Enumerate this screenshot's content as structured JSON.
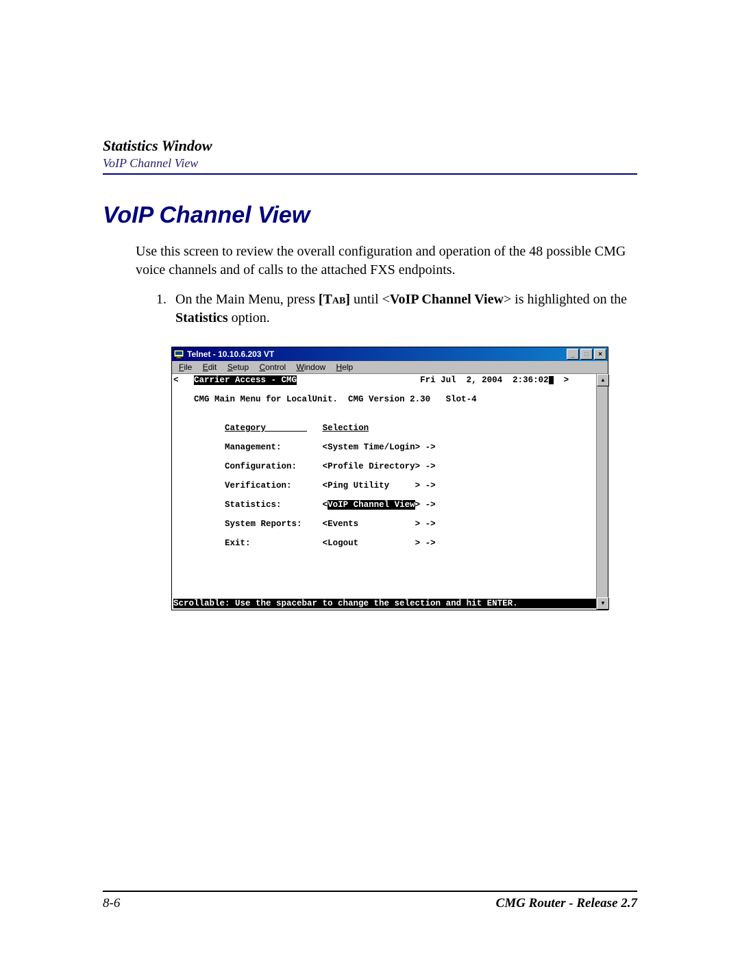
{
  "header": {
    "section_title": "Statistics Window",
    "subtitle": "VoIP Channel View"
  },
  "heading": "VoIP Channel View",
  "intro": "Use this screen to review the overall configuration and operation of the 48 possible CMG voice channels and of calls to the attached FXS endpoints.",
  "instruction": {
    "number": "1.",
    "pre": "On the Main Menu, press ",
    "key": "[Tab]",
    "mid": " until <",
    "highlight": "VoIP Channel View",
    "post1": "> is highlighted on the ",
    "stats_word": "Statistics",
    "post2": " option."
  },
  "telnet": {
    "title": "Telnet - 10.10.6.203 VT",
    "menus": {
      "file": "File",
      "edit": "Edit",
      "setup": "Setup",
      "control": "Control",
      "window": "Window",
      "help": "Help"
    },
    "top_left_arrow": "<",
    "banner": "Carrier Access - CMG",
    "datetime": "Fri Jul  2, 2004  2:36:02",
    "top_right_arrow": ">",
    "subheader": "CMG Main Menu for LocalUnit.  CMG Version 2.30   Slot-4",
    "col_category": "Category        ",
    "col_selection": "Selection",
    "rows": [
      {
        "cat": "Management:",
        "sel_pre": "<",
        "sel": "System Time/Login",
        "sel_post": "> ->"
      },
      {
        "cat": "Configuration:",
        "sel_pre": "<",
        "sel": "Profile Directory",
        "sel_post": "> ->"
      },
      {
        "cat": "Verification:",
        "sel_pre": "<",
        "sel": "Ping Utility     ",
        "sel_post": "> ->"
      },
      {
        "cat": "Statistics:",
        "sel_pre": "<",
        "sel": "VoIP Channel View",
        "sel_post": "> ->",
        "highlighted": true
      },
      {
        "cat": "System Reports:",
        "sel_pre": "<",
        "sel": "Events           ",
        "sel_post": "> ->"
      },
      {
        "cat": "Exit:",
        "sel_pre": "<",
        "sel": "Logout           ",
        "sel_post": "> ->"
      }
    ],
    "footer_hint": "Scrollable: Use the spacebar to change the selection and hit ENTER."
  },
  "footer": {
    "page_num": "8-6",
    "doc_title": "CMG Router - Release 2.7"
  }
}
